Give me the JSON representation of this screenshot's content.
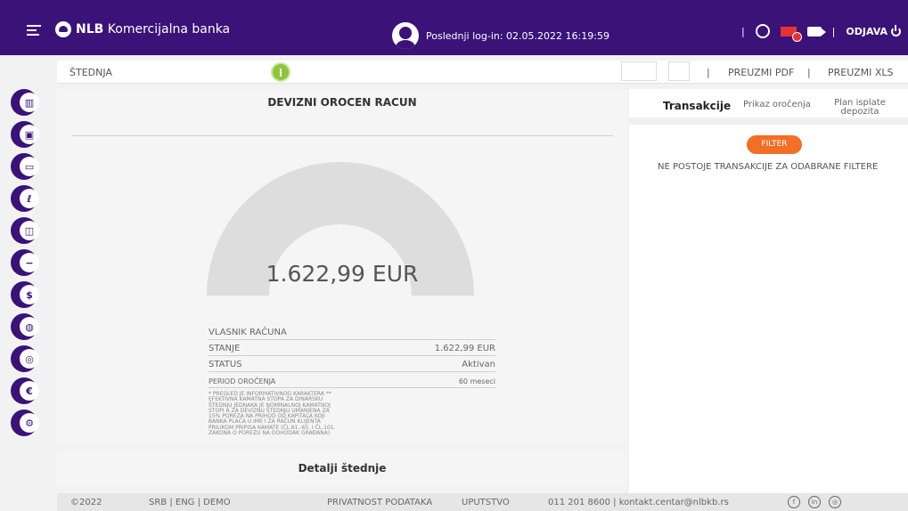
{
  "app": {
    "bank_name_bold": "NLB",
    "bank_name_rest": "Komercijalna banka",
    "last_login": "Poslednji log-in: 02.05.2022 16:19:59",
    "logout": "ODJAVA",
    "icons": [
      "menu-icon",
      "logo-icon",
      "avatar-icon",
      "whatsapp-icon",
      "mail-icon",
      "video-icon",
      "power-icon"
    ]
  },
  "subbar": {
    "title": "ŠTEDNJA",
    "export_pdf": "PREUZMI PDF",
    "export_xls": "PREUZMI XLS"
  },
  "sidebar": {
    "items": [
      {
        "icon": "chart-icon",
        "glyph": "▥"
      },
      {
        "icon": "briefcase-icon",
        "glyph": "▣"
      },
      {
        "icon": "card-icon",
        "glyph": "▭"
      },
      {
        "icon": "leaf-icon",
        "glyph": "ℓ"
      },
      {
        "icon": "money-icon",
        "glyph": "◫"
      },
      {
        "icon": "minus-card-icon",
        "glyph": "−"
      },
      {
        "icon": "dollar-icon",
        "glyph": "$"
      },
      {
        "icon": "coins-icon",
        "glyph": "◍"
      },
      {
        "icon": "location-icon",
        "glyph": "◎"
      },
      {
        "icon": "euro-icon",
        "glyph": "€"
      },
      {
        "icon": "settings-icon",
        "glyph": "⚙"
      }
    ]
  },
  "account": {
    "title": "DEVIZNI OROCEN RACUN",
    "amount": "1.622,99 EUR",
    "owner_label": "VLASNIK RAČUNA",
    "balance_label": "STANJE",
    "balance_value": "1.622,99 EUR",
    "status_label": "STATUS",
    "status_value": "Aktivan",
    "period_label": "PERIOD OROČENJA",
    "period_value": "60 meseci",
    "footnote": "* PREGLED JE INFORMATIVNOG KARAKTERA ** EFEKTIVNA KAMATNA STOPA ZA DINARSKU ŠTEDNJU JEDNAKA JE NOMINALNOJ KAMATNOJ STOPI A ZA DEVIZNU ŠTEDNJU UMANJENA ZA 15% POREZA NA PRIHOD OD KAPITALA KOJI BANKA PLAĆA U IME I ZA RAČUN KLIJENTA PRILIKOM PRIPISA KAMATE (ČL.61.-65. I ČL.101. ZAKONA O POREZU NA DOHODAK GRAĐANA)"
  },
  "transactions": {
    "tab_transactions": "Transakcije",
    "tab_term": "Prikaz oročenja",
    "tab_plan": "Plan isplate depozita",
    "filter": "FILTER",
    "empty": "NE POSTOJE TRANSAKCIJE ZA ODABRANE FILTERE"
  },
  "details_bar": {
    "label": "Detalji štednje"
  },
  "footer": {
    "copyright": "©2022",
    "languages": "SRB | ENG | DEMO",
    "privacy": "PRIVATNOST PODATAKA",
    "guide": "UPUTSTVO",
    "contact": "011 201 8600 | kontakt.centar@nlbkb.rs",
    "social_icons": [
      "facebook-icon",
      "linkedin-icon",
      "instagram-icon"
    ]
  }
}
